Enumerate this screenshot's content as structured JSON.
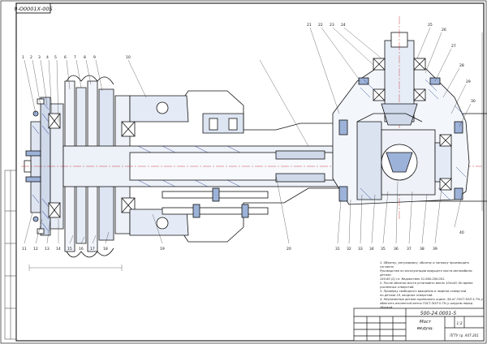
{
  "sheet": {
    "stamp_code": "9-О0001Х-00S",
    "title_block": {
      "designation": "500-24.0001-5",
      "name_line1": "Мост",
      "name_line2": "ведущ.",
      "scale_label": "1:2",
      "organization": "ПГТУ гр. АХТ-201"
    },
    "notes": [
      "1. Обкатку, регулировку, обкатку и затяжку производить согласно",
      "Руководства по эксплуатации ведущего моста автомобиля; детали",
      "150-60 (2) гл. Ведомствен 51-600.200.001.",
      "2. После обкатки моста установить масло 10лч40. Во время",
      "усиленных отверстий.",
      "3. Проверку свободного вращения и люфтов отверстий",
      "по детали 19, входных отверстий.",
      "4. Неуказанные детали оцинковать оцинк. ЗА-пГ-ГОСТ.ЗОЛ 5.7%-у",
      "обмотать изолентой ленты ГОСТ-ЗОЛ 5.7%-у шнуром перед сборкой."
    ],
    "callouts_left": [
      "1",
      "2",
      "3",
      "4",
      "5",
      "6",
      "7",
      "8",
      "9",
      "10",
      "11",
      "12",
      "13",
      "14",
      "15",
      "16",
      "17",
      "18",
      "19",
      "20"
    ],
    "callouts_right": [
      "21",
      "22",
      "23",
      "24",
      "25",
      "26",
      "27",
      "28",
      "29",
      "30",
      "31",
      "32",
      "33",
      "34",
      "35",
      "36",
      "37",
      "38",
      "39",
      "40"
    ]
  }
}
